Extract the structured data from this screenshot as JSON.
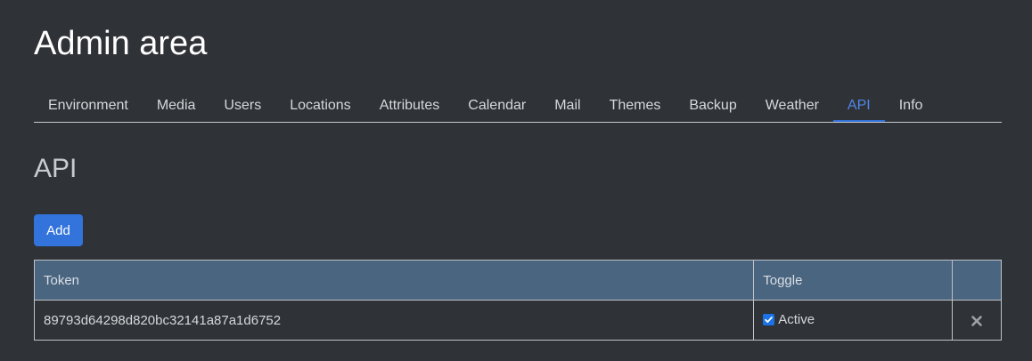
{
  "page": {
    "title": "Admin area"
  },
  "tabs": [
    {
      "label": "Environment",
      "active": false
    },
    {
      "label": "Media",
      "active": false
    },
    {
      "label": "Users",
      "active": false
    },
    {
      "label": "Locations",
      "active": false
    },
    {
      "label": "Attributes",
      "active": false
    },
    {
      "label": "Calendar",
      "active": false
    },
    {
      "label": "Mail",
      "active": false
    },
    {
      "label": "Themes",
      "active": false
    },
    {
      "label": "Backup",
      "active": false
    },
    {
      "label": "Weather",
      "active": false
    },
    {
      "label": "API",
      "active": true
    },
    {
      "label": "Info",
      "active": false
    }
  ],
  "section": {
    "title": "API",
    "add_label": "Add"
  },
  "table": {
    "headers": {
      "token": "Token",
      "toggle": "Toggle",
      "action": ""
    },
    "rows": [
      {
        "token": "89793d64298d820bc32141a87a1d6752",
        "toggle_label": "Active",
        "checked": true
      }
    ]
  },
  "colors": {
    "accent": "#3273dc",
    "background": "#2f3236",
    "table_header": "#4a6580"
  },
  "icons": {
    "delete": "close-icon",
    "checkbox": "checkmark-icon"
  }
}
